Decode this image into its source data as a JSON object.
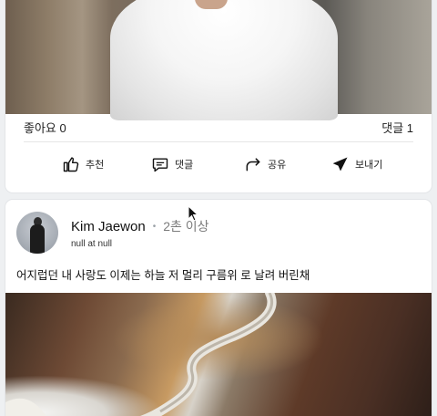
{
  "post1": {
    "likes_label": "좋아요 0",
    "comments_label": "댓글 1",
    "actions": [
      {
        "label": "추천",
        "icon": "thumbs-up-icon"
      },
      {
        "label": "댓글",
        "icon": "comment-icon"
      },
      {
        "label": "공유",
        "icon": "share-icon"
      },
      {
        "label": "보내기",
        "icon": "send-icon"
      }
    ]
  },
  "post2": {
    "author": "Kim Jaewon",
    "separator": "•",
    "time": "2촌 이상",
    "location": "null at null",
    "text": "어지럽던 내 사랑도 이제는 하늘 저 멀리 구름위 로 날려 버린채"
  }
}
